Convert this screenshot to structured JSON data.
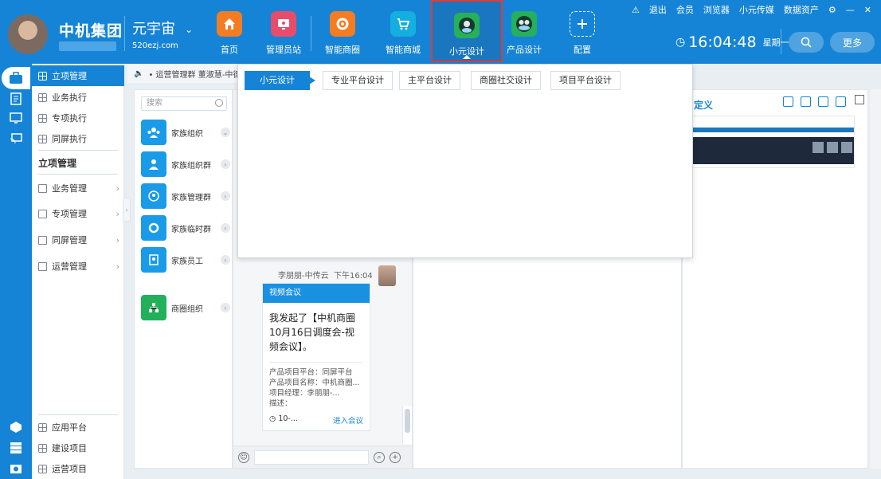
{
  "header": {
    "brand": "中机集团",
    "workspace": "元宇宙",
    "workspace_url": "520ezj.com",
    "nav": [
      {
        "label": "首页",
        "icon": "home-icon",
        "color": "#f57c22",
        "glyph": "⌂"
      },
      {
        "label": "管理员站",
        "icon": "monitor-icon",
        "color": "#e94c6b",
        "glyph": "▣"
      },
      {
        "label": "智能商圈",
        "icon": "ring-icon",
        "color": "#f57c22",
        "glyph": "◉"
      },
      {
        "label": "智能商城",
        "icon": "cart-icon",
        "color": "#15aee0",
        "glyph": "🛒"
      },
      {
        "label": "小元设计",
        "icon": "globe-avatar-icon",
        "color": "#26b05a",
        "glyph": "●"
      },
      {
        "label": "产品设计",
        "icon": "duo-avatar-icon",
        "color": "#26b05a",
        "glyph": "●●"
      },
      {
        "label": "配置",
        "icon": "plus-icon",
        "color": "#1584d6",
        "glyph": "+"
      }
    ],
    "links": [
      "退出",
      "会员",
      "浏览器",
      "小元传媒",
      "数据资产"
    ],
    "time": "16:04:48",
    "weekday": "星期一",
    "more": "更多"
  },
  "sidebar": {
    "top_items": [
      "立项管理",
      "业务执行",
      "专项执行",
      "同屏执行"
    ],
    "section_title": "立项管理",
    "groups": [
      "业务管理",
      "专项管理",
      "同屏管理",
      "运营管理"
    ],
    "bottom_items": [
      "应用平台",
      "建设项目",
      "运营项目"
    ]
  },
  "marquee": "• 运营管理群 董淑慧-中德",
  "contacts": {
    "search_placeholder": "搜索",
    "items": [
      {
        "name": "家族组织",
        "icon": "team-icon",
        "color": "#1a9be8"
      },
      {
        "name": "家族组织群",
        "icon": "person-icon",
        "color": "#1a9be8"
      },
      {
        "name": "家族管理群",
        "icon": "pin-icon",
        "color": "#1a9be8"
      },
      {
        "name": "家族临时群",
        "icon": "ring-icon",
        "color": "#1a9be8"
      },
      {
        "name": "家族员工",
        "icon": "badge-icon",
        "color": "#1a9be8"
      },
      {
        "name": "商圈组织",
        "icon": "org-icon",
        "color": "#22b05a"
      }
    ]
  },
  "chat": {
    "sender": "李朋朋-中传云",
    "time": "下午16:04",
    "card": {
      "header": "视频会议",
      "body": "我发起了【中机商圈10月16日调度会-视频会议】。",
      "meta": [
        "产品项目平台：同屏平台",
        "产品项目名称：中机商圈...",
        "项目经理：李朋朋-...",
        "描述："
      ],
      "time": "10-...",
      "join": "进入会议"
    }
  },
  "right_panel": {
    "title": "定义"
  },
  "dropdown": {
    "tabs": [
      "小元设计",
      "专业平台设计",
      "主平台设计",
      "商圈社交设计",
      "项目平台设计"
    ],
    "active": 0
  }
}
